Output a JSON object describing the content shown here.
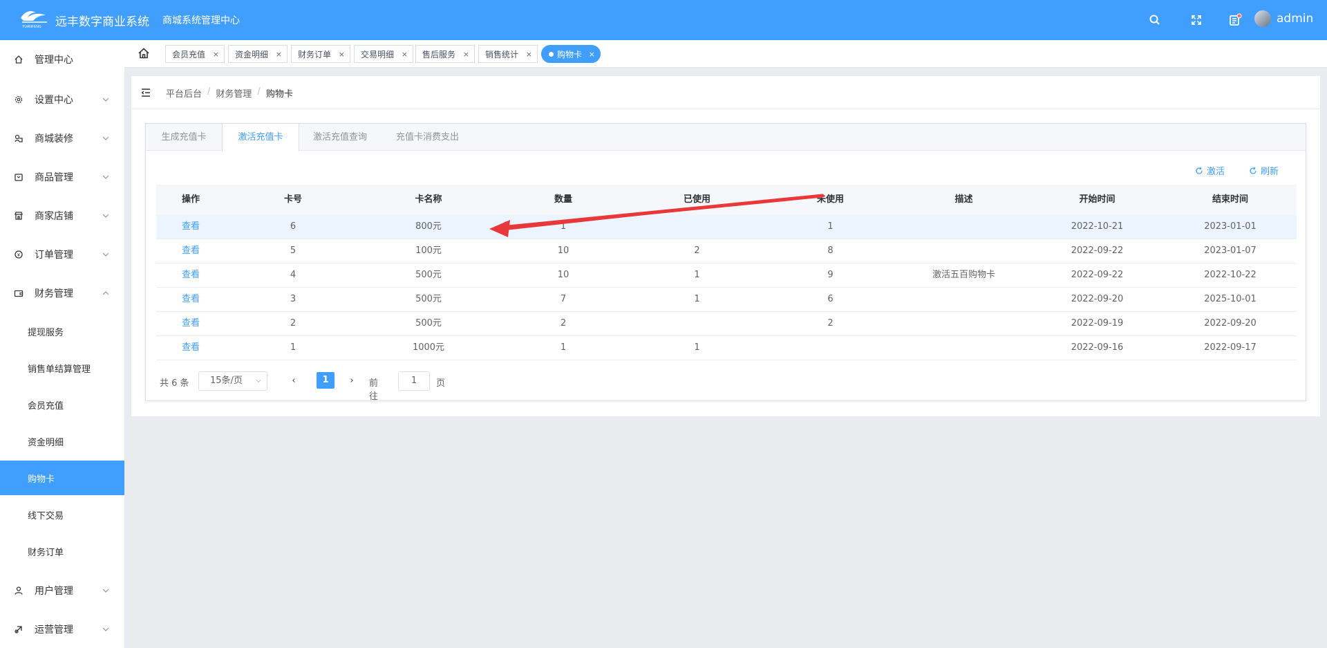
{
  "header": {
    "brand": "远丰数字商业系统",
    "logo_text": "YUANFENG",
    "subsystem": "商城系统管理中心",
    "username": "admin",
    "notification_color": "#f56c6c"
  },
  "sidebar": {
    "items": [
      {
        "label": "管理中心",
        "icon": "home-icon"
      },
      {
        "label": "设置中心",
        "icon": "gear-icon"
      },
      {
        "label": "商城装修",
        "icon": "decor-icon"
      },
      {
        "label": "商品管理",
        "icon": "goods-icon"
      },
      {
        "label": "商家店铺",
        "icon": "store-icon"
      },
      {
        "label": "订单管理",
        "icon": "order-icon"
      },
      {
        "label": "财务管理",
        "icon": "wallet-icon"
      }
    ],
    "finance_sub": [
      "提现服务",
      "销售单结算管理",
      "会员充值",
      "资金明细",
      "购物卡",
      "线下交易",
      "财务订单"
    ],
    "active_sub": "购物卡",
    "bottom_items": [
      {
        "label": "用户管理",
        "icon": "user-icon"
      },
      {
        "label": "运营管理",
        "icon": "ops-icon"
      }
    ]
  },
  "tags": [
    "会员充值",
    "资金明细",
    "财务订单",
    "交易明细",
    "售后服务",
    "销售统计",
    "购物卡"
  ],
  "breadcrumb": {
    "a": "平台后台",
    "b": "财务管理",
    "c": "购物卡",
    "sep": "/"
  },
  "card_tabs": [
    "生成充值卡",
    "激活充值卡",
    "激活充值查询",
    "充值卡消费支出"
  ],
  "toolbar": {
    "activate": "激活",
    "refresh": "刷新"
  },
  "table": {
    "headers": [
      "操作",
      "卡号",
      "卡名称",
      "数量",
      "已使用",
      "未使用",
      "描述",
      "开始时间",
      "结束时间"
    ],
    "rows": [
      {
        "op": "查看",
        "no": "6",
        "name": "800元",
        "qty": "1",
        "used": "",
        "unused": "1",
        "desc": "",
        "start": "2022-10-21",
        "end": "2023-01-01"
      },
      {
        "op": "查看",
        "no": "5",
        "name": "100元",
        "qty": "10",
        "used": "2",
        "unused": "8",
        "desc": "",
        "start": "2022-09-22",
        "end": "2023-01-07"
      },
      {
        "op": "查看",
        "no": "4",
        "name": "500元",
        "qty": "10",
        "used": "1",
        "unused": "9",
        "desc": "激活五百购物卡",
        "start": "2022-09-22",
        "end": "2022-10-22"
      },
      {
        "op": "查看",
        "no": "3",
        "name": "500元",
        "qty": "7",
        "used": "1",
        "unused": "6",
        "desc": "",
        "start": "2022-09-20",
        "end": "2025-10-01"
      },
      {
        "op": "查看",
        "no": "2",
        "name": "500元",
        "qty": "2",
        "used": "",
        "unused": "2",
        "desc": "",
        "start": "2022-09-19",
        "end": "2022-09-20"
      },
      {
        "op": "查看",
        "no": "1",
        "name": "1000元",
        "qty": "1",
        "used": "1",
        "unused": "",
        "desc": "",
        "start": "2022-09-16",
        "end": "2022-09-17"
      }
    ]
  },
  "pager": {
    "total": "共 6 条",
    "page_size": "15条/页",
    "current": "1",
    "goto_label": "前往",
    "goto_value": "1",
    "page_unit": "页",
    "prev": "‹",
    "next": "›"
  },
  "annotation": {
    "color": "#e8383a"
  }
}
